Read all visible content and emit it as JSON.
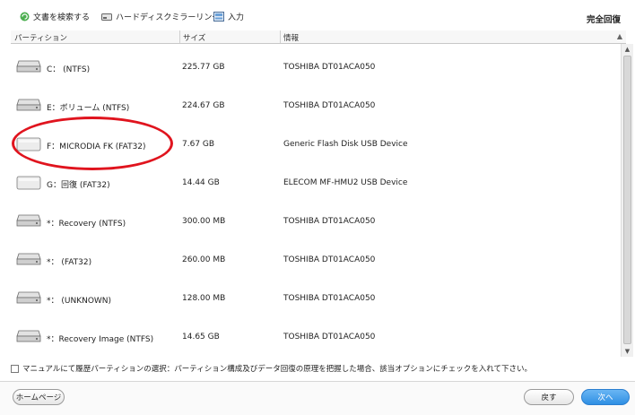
{
  "toolbar": {
    "search_label": "文書を検索する",
    "mirror_label": "ハードディスクミラーリング",
    "input_label": "入力",
    "mode_label": "完全回復"
  },
  "columns": {
    "partition": "パーティション",
    "size": "サイズ",
    "info": "情報"
  },
  "rows": [
    {
      "name": "C：  (NTFS)",
      "size": "225.77 GB",
      "info": "TOSHIBA DT01ACA050",
      "icon": "hdd-icon"
    },
    {
      "name": "E：ボリューム  (NTFS)",
      "size": "224.67 GB",
      "info": "TOSHIBA DT01ACA050",
      "icon": "hdd-icon"
    },
    {
      "name": "F：MICRODIA FK  (FAT32)",
      "size": "7.67 GB",
      "info": "Generic   Flash Disk   USB Device",
      "icon": "usb-drive-icon"
    },
    {
      "name": "G：回復  (FAT32)",
      "size": "14.44 GB",
      "info": "ELECOM   MF-HMU2   USB Device",
      "icon": "usb-drive-icon"
    },
    {
      "name": "*：Recovery  (NTFS)",
      "size": "300.00 MB",
      "info": "TOSHIBA DT01ACA050",
      "icon": "hdd-icon"
    },
    {
      "name": "*：   (FAT32)",
      "size": "260.00 MB",
      "info": "TOSHIBA DT01ACA050",
      "icon": "hdd-icon"
    },
    {
      "name": "*：   (UNKNOWN)",
      "size": "128.00 MB",
      "info": "TOSHIBA DT01ACA050",
      "icon": "hdd-icon"
    },
    {
      "name": "*：Recovery Image  (NTFS)",
      "size": "14.65 GB",
      "info": "TOSHIBA DT01ACA050",
      "icon": "hdd-icon"
    }
  ],
  "option_text": "マニュアルにて履歴パーティションの選択：パーティション構成及びデータ回復の原理を把握した場合、該当オプションにチェックを入れて下さい。",
  "buttons": {
    "home": "ホームページ",
    "back": "戻す",
    "next": "次へ"
  },
  "colors": {
    "accent": "#2f8fe3",
    "highlight": "#e0141e"
  }
}
